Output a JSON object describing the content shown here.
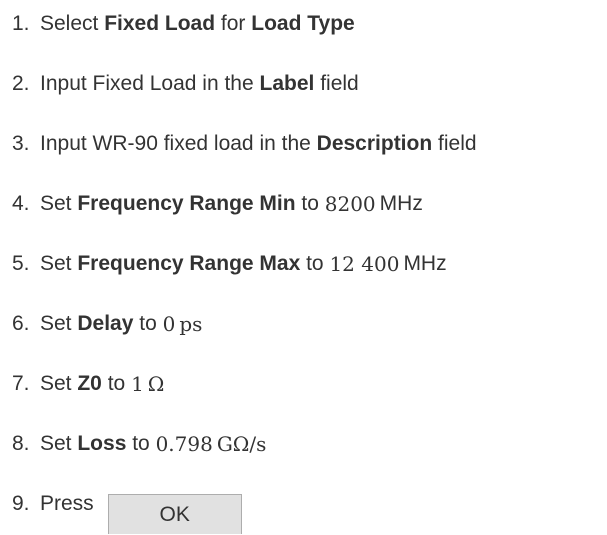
{
  "steps": [
    {
      "num": "1.",
      "parts": [
        "Select ",
        "Fixed Load",
        " for ",
        "Load Type"
      ]
    },
    {
      "num": "2.",
      "parts": [
        "Input Fixed Load in the ",
        "Label",
        " field"
      ]
    },
    {
      "num": "3.",
      "parts": [
        "Input WR-90 fixed load in the ",
        "Description",
        " field"
      ]
    },
    {
      "num": "4.",
      "parts": [
        "Set ",
        "Frequency Range Min",
        " to ",
        "8200",
        "MHz"
      ]
    },
    {
      "num": "5.",
      "parts": [
        "Set ",
        "Frequency Range Max",
        " to ",
        "12 400",
        "MHz"
      ]
    },
    {
      "num": "6.",
      "parts": [
        "Set ",
        "Delay",
        " to ",
        "0",
        "ps"
      ]
    },
    {
      "num": "7.",
      "parts": [
        "Set ",
        "Z0",
        " to ",
        "1",
        "Ω"
      ]
    },
    {
      "num": "8.",
      "parts": [
        "Set ",
        "Loss",
        " to ",
        "0.798",
        "GΩ/s"
      ]
    },
    {
      "num": "9.",
      "parts": [
        "Press"
      ]
    }
  ],
  "ok_button": {
    "label": "OK"
  }
}
